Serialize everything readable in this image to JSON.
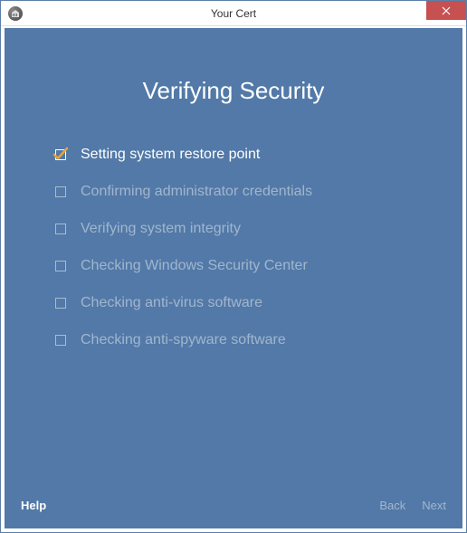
{
  "window": {
    "title": "Your Cert"
  },
  "heading": "Verifying Security",
  "steps": [
    {
      "label": "Setting system restore point",
      "state": "active"
    },
    {
      "label": "Confirming administrator credentials",
      "state": "pending"
    },
    {
      "label": "Verifying system integrity",
      "state": "pending"
    },
    {
      "label": "Checking Windows Security Center",
      "state": "pending"
    },
    {
      "label": "Checking anti-virus software",
      "state": "pending"
    },
    {
      "label": "Checking anti-spyware software",
      "state": "pending"
    }
  ],
  "footer": {
    "help": "Help",
    "back": "Back",
    "next": "Next"
  }
}
